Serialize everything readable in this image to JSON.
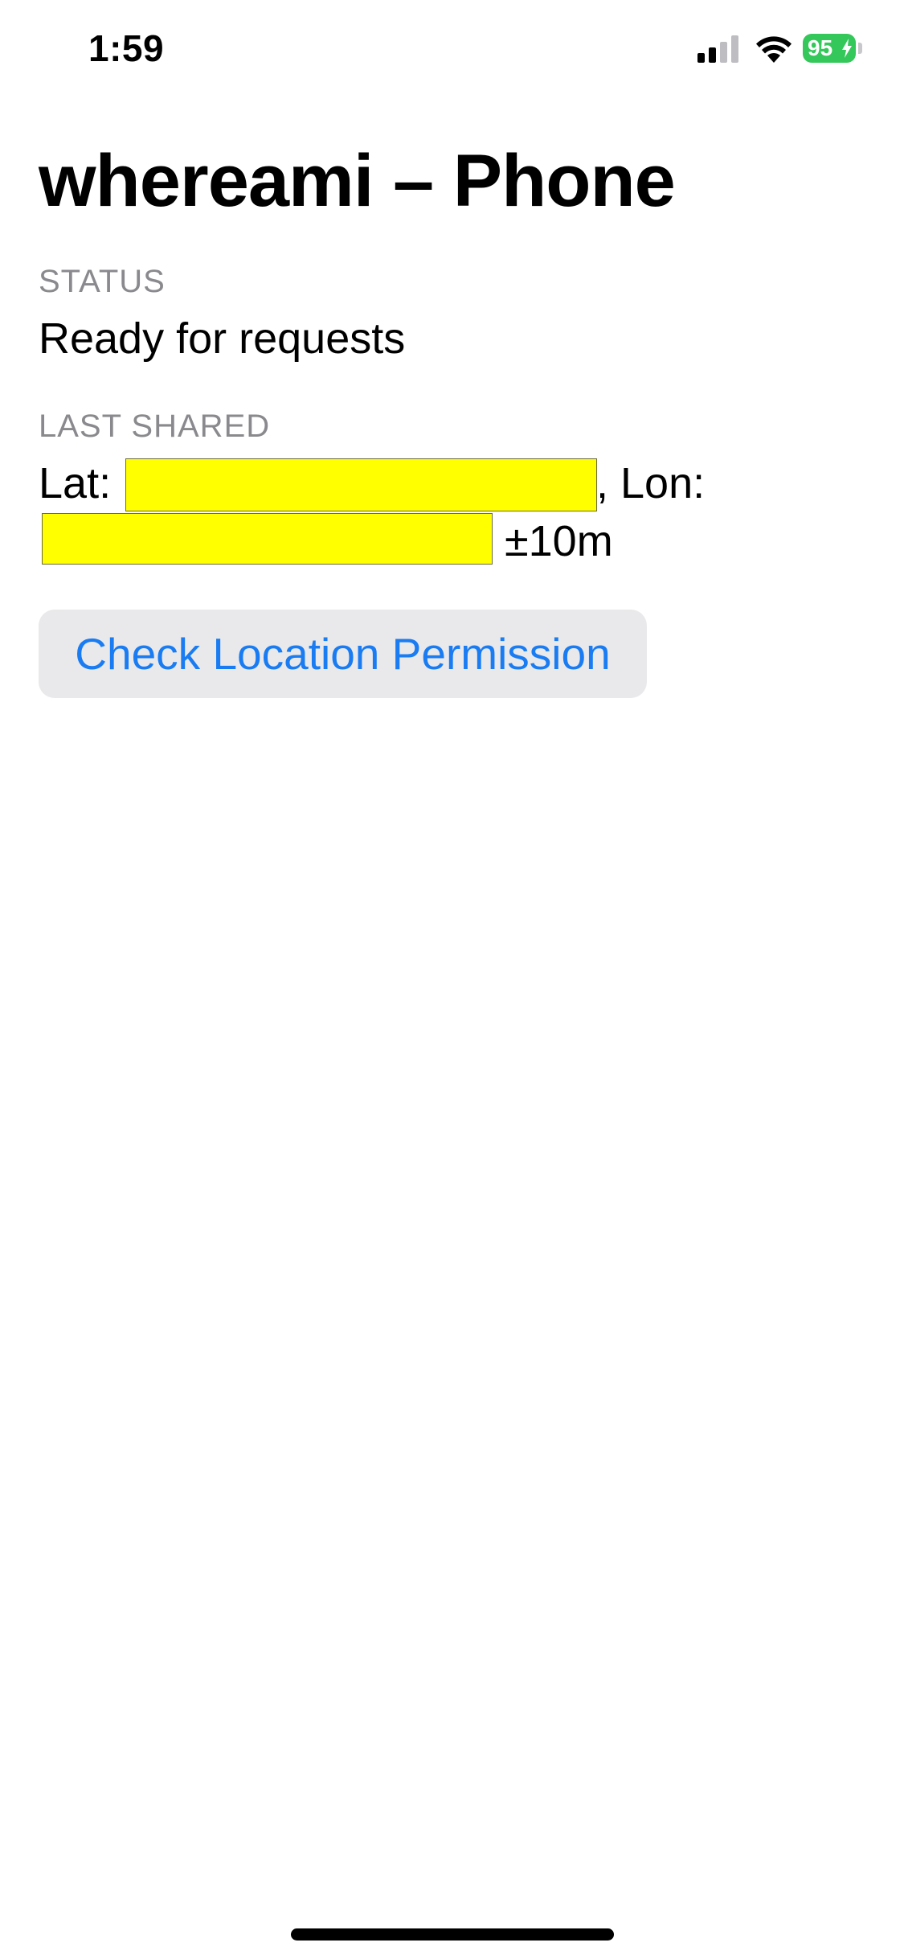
{
  "status_bar": {
    "time": "1:59",
    "battery_percent": "95",
    "signal_icon": "cellular-signal-icon",
    "wifi_icon": "wifi-icon",
    "battery_icon": "battery-charging-icon",
    "battery_color": "#34c759"
  },
  "header": {
    "title": "whereami – Phone"
  },
  "status_section": {
    "label": "STATUS",
    "value": "Ready for requests"
  },
  "last_shared_section": {
    "label": "LAST SHARED",
    "lat_label": "Lat:",
    "lon_label": ", Lon:",
    "accuracy": "±10m",
    "redaction_color": "#ffff00"
  },
  "actions": {
    "check_permission_label": "Check Location Permission",
    "accent_color": "#1a7cf2"
  }
}
